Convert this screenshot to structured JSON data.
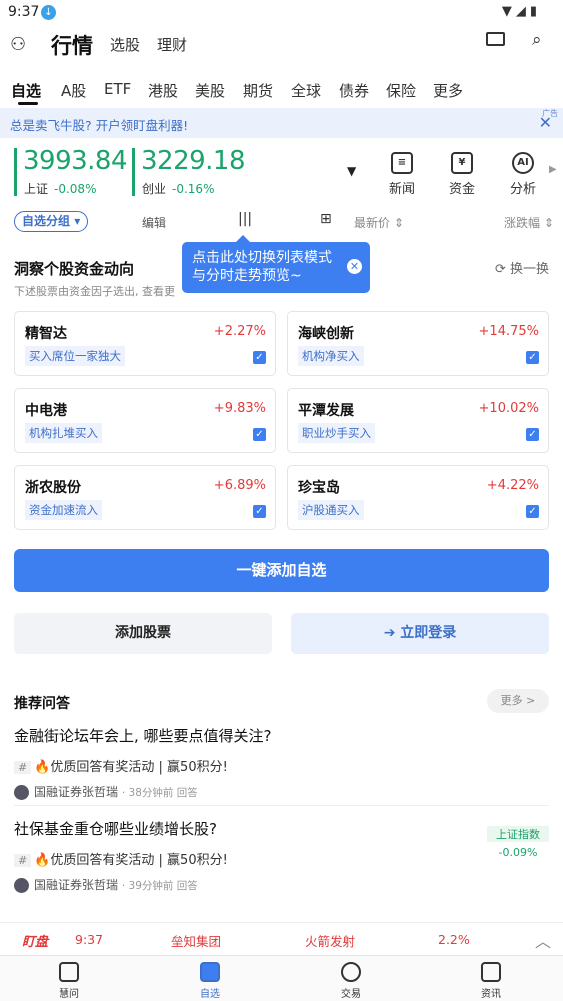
{
  "statusbar": {
    "time": "9:37"
  },
  "topbar": {
    "title": "行情",
    "tabs": [
      "选股",
      "理财"
    ]
  },
  "market_tabs": [
    "自选",
    "A股",
    "ETF",
    "港股",
    "美股",
    "期货",
    "全球",
    "债券",
    "保险",
    "更多"
  ],
  "ad": {
    "text": "总是卖飞牛股? 开户领盯盘利器!",
    "tag": "广告"
  },
  "indices": [
    {
      "value": "3993.84",
      "name": "上证",
      "change": "-0.08%"
    },
    {
      "value": "3229.18",
      "name": "创业",
      "change": "-0.16%"
    }
  ],
  "quick_links": [
    "新闻",
    "资金",
    "分析"
  ],
  "toolbar": {
    "group": "自选分组",
    "edit": "编辑",
    "price": "最新价",
    "change": "涨跌幅"
  },
  "tooltip": "点击此处切换列表模式与分时走势预览~",
  "section": {
    "title": "洞察个股资金动向",
    "subtitle": "下述股票由资金因子选出, 查看更",
    "refresh": "换一换"
  },
  "stocks": [
    {
      "name": "精智达",
      "pct": "+2.27%",
      "tag": "买入席位一家独大"
    },
    {
      "name": "海峡创新",
      "pct": "+14.75%",
      "tag": "机构净买入"
    },
    {
      "name": "中电港",
      "pct": "+9.83%",
      "tag": "机构扎堆买入"
    },
    {
      "name": "平潭发展",
      "pct": "+10.02%",
      "tag": "职业炒手买入"
    },
    {
      "name": "浙农股份",
      "pct": "+6.89%",
      "tag": "资金加速流入"
    },
    {
      "name": "珍宝岛",
      "pct": "+4.22%",
      "tag": "沪股通买入"
    }
  ],
  "buttons": {
    "add_all": "一键添加自选",
    "add_stock": "添加股票",
    "login": "立即登录"
  },
  "qa": {
    "title": "推荐问答",
    "more": "更多 >",
    "items": [
      {
        "question": "金融街论坛年会上, 哪些要点值得关注?",
        "activity": "🔥优质回答有奖活动 | 赢50积分!",
        "author": "国融证券张哲瑞",
        "time": "· 38分钟前 回答"
      },
      {
        "question": "社保基金重仓哪些业绩增长股?",
        "activity": "🔥优质回答有奖活动 | 赢50积分!",
        "author": "国融证券张哲瑞",
        "time": "· 39分钟前 回答"
      }
    ]
  },
  "side_index": {
    "name": "上证指数",
    "value": "-0.09%"
  },
  "ticker": {
    "logo": "盯盘",
    "time": "9:37",
    "stock1": "垒知集团",
    "stock2": "火箭发射",
    "pct": "2.2%"
  },
  "bottom_nav": [
    "慧问",
    "自选",
    "交易",
    "资讯"
  ]
}
